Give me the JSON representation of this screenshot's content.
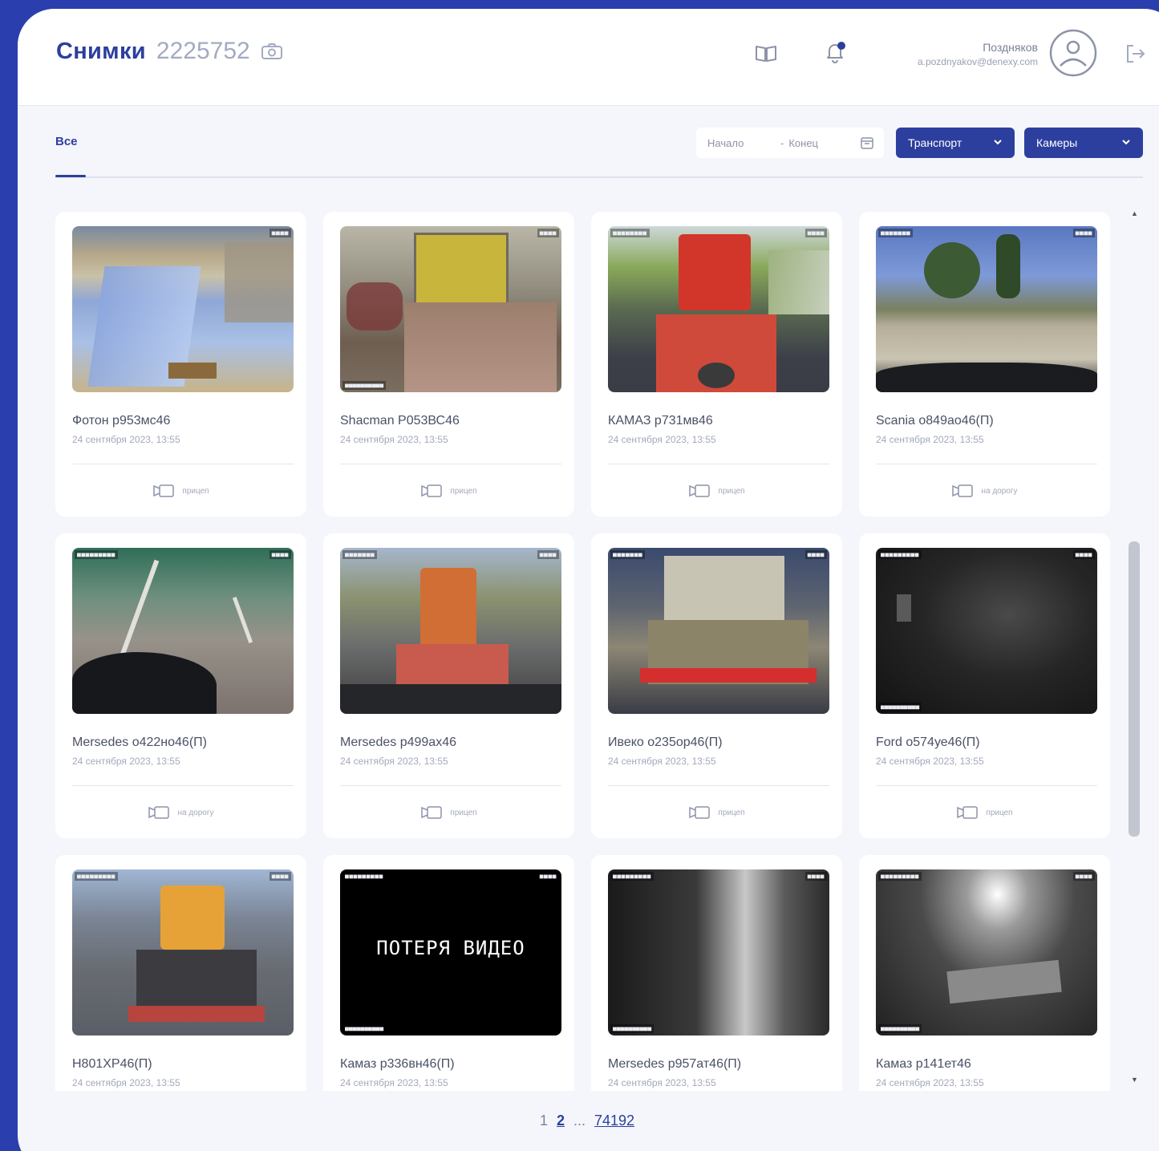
{
  "header": {
    "title": "Снимки",
    "count": "2225752",
    "user_name": "Поздняков",
    "user_email": "a.pozdnyakov@denexy.com"
  },
  "toolbar": {
    "tab_all": "Все",
    "date_start_placeholder": "Начало",
    "date_separator": "-",
    "date_end_placeholder": "Конец",
    "transport_label": "Транспорт",
    "cameras_label": "Камеры"
  },
  "cards": [
    {
      "title": "Фотон р953мс46",
      "date": "24 сентября 2023, 13:55",
      "camera": "прицеп"
    },
    {
      "title": "Shacman Р053ВС46",
      "date": "24 сентября 2023, 13:55",
      "camera": "прицеп"
    },
    {
      "title": "КАМАЗ р731мв46",
      "date": "24 сентября 2023, 13:55",
      "camera": "прицеп"
    },
    {
      "title": "Scania о849ао46(П)",
      "date": "24 сентября 2023, 13:55",
      "camera": "на дорогу"
    },
    {
      "title": "Mersedes о422но46(П)",
      "date": "24 сентября 2023, 13:55",
      "camera": "на дорогу"
    },
    {
      "title": "Mersedes р499ах46",
      "date": "24 сентября 2023, 13:55",
      "camera": "прицеп"
    },
    {
      "title": "Ивеко о235ор46(П)",
      "date": "24 сентября 2023, 13:55",
      "camera": "прицеп"
    },
    {
      "title": "Ford о574уе46(П)",
      "date": "24 сентября 2023, 13:55",
      "camera": "прицеп"
    },
    {
      "title": "Н801ХР46(П)",
      "date": "24 сентября 2023, 13:55",
      "camera": ""
    },
    {
      "title": "Камаз р336вн46(П)",
      "date": "24 сентября 2023, 13:55",
      "camera": ""
    },
    {
      "title": "Mersedes р957ат46(П)",
      "date": "24 сентября 2023, 13:55",
      "camera": ""
    },
    {
      "title": "Камаз р141ет46",
      "date": "24 сентября 2023, 13:55",
      "camera": ""
    }
  ],
  "video_lost_text": "ПОТЕРЯ ВИДЕО",
  "pagination": {
    "page_1": "1",
    "page_2": "2",
    "ellipsis": "...",
    "last_page": "74192"
  },
  "colors": {
    "accent": "#2c3f9e",
    "frame": "#2a3fad",
    "background": "#f4f6fb"
  }
}
